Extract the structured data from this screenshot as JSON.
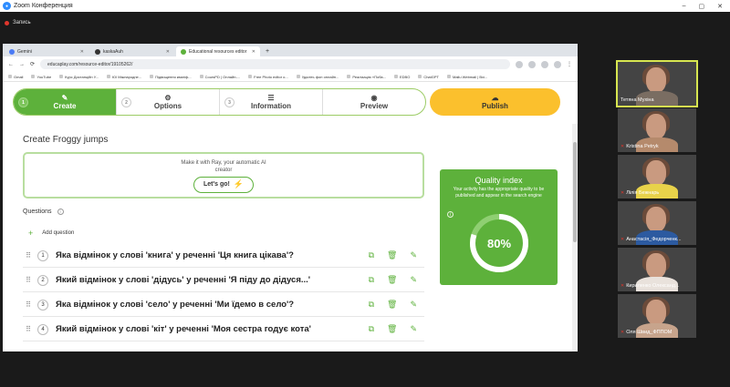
{
  "window": {
    "title": "Zoom Конференция",
    "minimize": "–",
    "maximize": "▢",
    "close": "✕"
  },
  "zoom": {
    "record_label": "Запись"
  },
  "browser": {
    "tabs": [
      {
        "label": "Gemini",
        "color": "#4b7bf5"
      },
      {
        "label": "kaskaAuh",
        "color": "#333333"
      },
      {
        "label": "Educational resources editor",
        "color": "#5db13b"
      }
    ],
    "new_tab": "+",
    "url": "educaplay.com/resource-editor/19105262/",
    "bookmarks": [
      "Gmail",
      "YouTube",
      "Курс Дистанційн У...",
      "ЮІ Міжнародне...",
      "Підвищення кваліф...",
      "CoursPD | Онлайн-...",
      "Free Photo editor o...",
      "Удаліть фон онлайн...",
      "Реалізацію «Поба...",
      "EDBO",
      "ChatGPT",
      "Mailu Webmail | Вхі..."
    ]
  },
  "editor": {
    "steps": [
      {
        "num": "1",
        "label": "Create",
        "icon": "✎"
      },
      {
        "num": "2",
        "label": "Options",
        "icon": "⚙"
      },
      {
        "num": "3",
        "label": "Information",
        "icon": "☰"
      },
      {
        "num": "",
        "label": "Preview",
        "icon": "◉"
      }
    ],
    "publish": {
      "label": "Publish",
      "icon": "☁"
    },
    "page_title": "Create Froggy jumps",
    "ray": {
      "line1": "Make it with Ray, your automatic AI",
      "line2": "creator",
      "button": "Let's go!",
      "icon": "⚡"
    },
    "questions_label": "Questions",
    "info_icon": "i",
    "add_question": "Add question",
    "questions": [
      {
        "num": "1",
        "text": "Яка відмінок у слові 'книга' у реченні 'Ця книга цікава'?"
      },
      {
        "num": "2",
        "text": "Який відмінок у слові 'дідусь' у реченні 'Я піду до дідуся...'"
      },
      {
        "num": "3",
        "text": "Яка відмінок у слові 'село' у реченні 'Ми їдемо в село'?"
      },
      {
        "num": "4",
        "text": "Який відмінок у слові 'кіт' у реченні 'Моя сестра годує кота'"
      }
    ],
    "row_icons": {
      "drag": "⠿",
      "copy": "⧉",
      "delete": "🗑",
      "edit": "✎"
    },
    "quality": {
      "title": "Quality index",
      "desc": "Your activity has the appropriate quality to be published and appear in the search engine",
      "percent_label": "80%",
      "percent": 80,
      "info": "i"
    }
  },
  "participants": [
    {
      "name": "Тетяна Мухіна",
      "muted": false,
      "speaking": true
    },
    {
      "name": "Kristina Petryk",
      "muted": true,
      "speaking": false
    },
    {
      "name": "Лілія Бежнарь",
      "muted": true,
      "speaking": false
    },
    {
      "name": "Анастасія_Федорченк...",
      "muted": true,
      "speaking": false
    },
    {
      "name": "Кириленко Олександ...",
      "muted": true,
      "speaking": false
    },
    {
      "name": "Оля Швид_ФППОМ",
      "muted": true,
      "speaking": false
    }
  ],
  "colors": {
    "accent": "#5db13b",
    "publish": "#fbc02d",
    "zoom_bg": "#1a1a1a"
  }
}
